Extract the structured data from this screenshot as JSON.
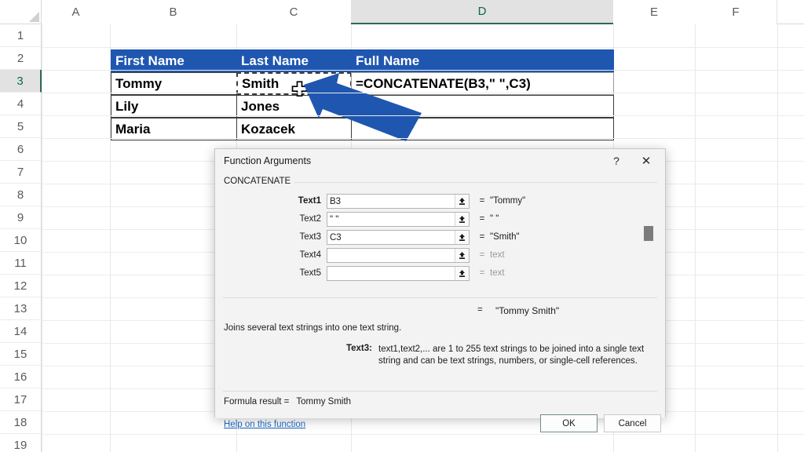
{
  "spreadsheet": {
    "columns": [
      "A",
      "B",
      "C",
      "D",
      "E",
      "F"
    ],
    "selected_column": "D",
    "rows": [
      "1",
      "2",
      "3",
      "4",
      "5",
      "6",
      "7",
      "8",
      "9",
      "10",
      "11",
      "12",
      "13",
      "14",
      "15",
      "16",
      "17",
      "18",
      "19"
    ],
    "selected_row": "3",
    "table": {
      "headers": [
        "First Name",
        "Last Name",
        "Full Name"
      ],
      "rows": [
        {
          "first": "Tommy",
          "last": "Smith",
          "full": "=CONCATENATE(B3,\" \",C3)"
        },
        {
          "first": "Lily",
          "last": "Jones",
          "full": ""
        },
        {
          "first": "Maria",
          "last": "Kozacek",
          "full": ""
        }
      ],
      "header_color": "#1F56B0",
      "copied_cell": "C3",
      "active_cell": "D3"
    },
    "cursor_icon": "plus-cell-cursor",
    "pointer_icon": "blue-arrow-annotation"
  },
  "dialog": {
    "title": "Function Arguments",
    "help_button": "?",
    "close_button": "✕",
    "function_name": "CONCATENATE",
    "arguments": [
      {
        "label": "Text1",
        "value": "B3",
        "result": "\"Tommy\"",
        "is_placeholder": false,
        "bold": true
      },
      {
        "label": "Text2",
        "value": "\" \"",
        "result": "\" \"",
        "is_placeholder": false,
        "bold": false
      },
      {
        "label": "Text3",
        "value": "C3",
        "result": "\"Smith\"",
        "is_placeholder": false,
        "bold": false
      },
      {
        "label": "Text4",
        "value": "",
        "result": "text",
        "is_placeholder": true,
        "bold": false
      },
      {
        "label": "Text5",
        "value": "",
        "result": "text",
        "is_placeholder": true,
        "bold": false
      }
    ],
    "equals_sign": "=",
    "overall_result": "\"Tommy Smith\"",
    "function_description": "Joins several text strings into one text string.",
    "current_arg_label": "Text3:",
    "current_arg_help": "text1,text2,... are 1 to 255 text strings to be joined into a single text string and can be text strings, numbers, or single-cell references.",
    "formula_result_label": "Formula result =",
    "formula_result_value": "Tommy Smith",
    "help_link": "Help on this function",
    "ok_button": "OK",
    "cancel_button": "Cancel",
    "collapse_icon": "range-selector-icon"
  }
}
